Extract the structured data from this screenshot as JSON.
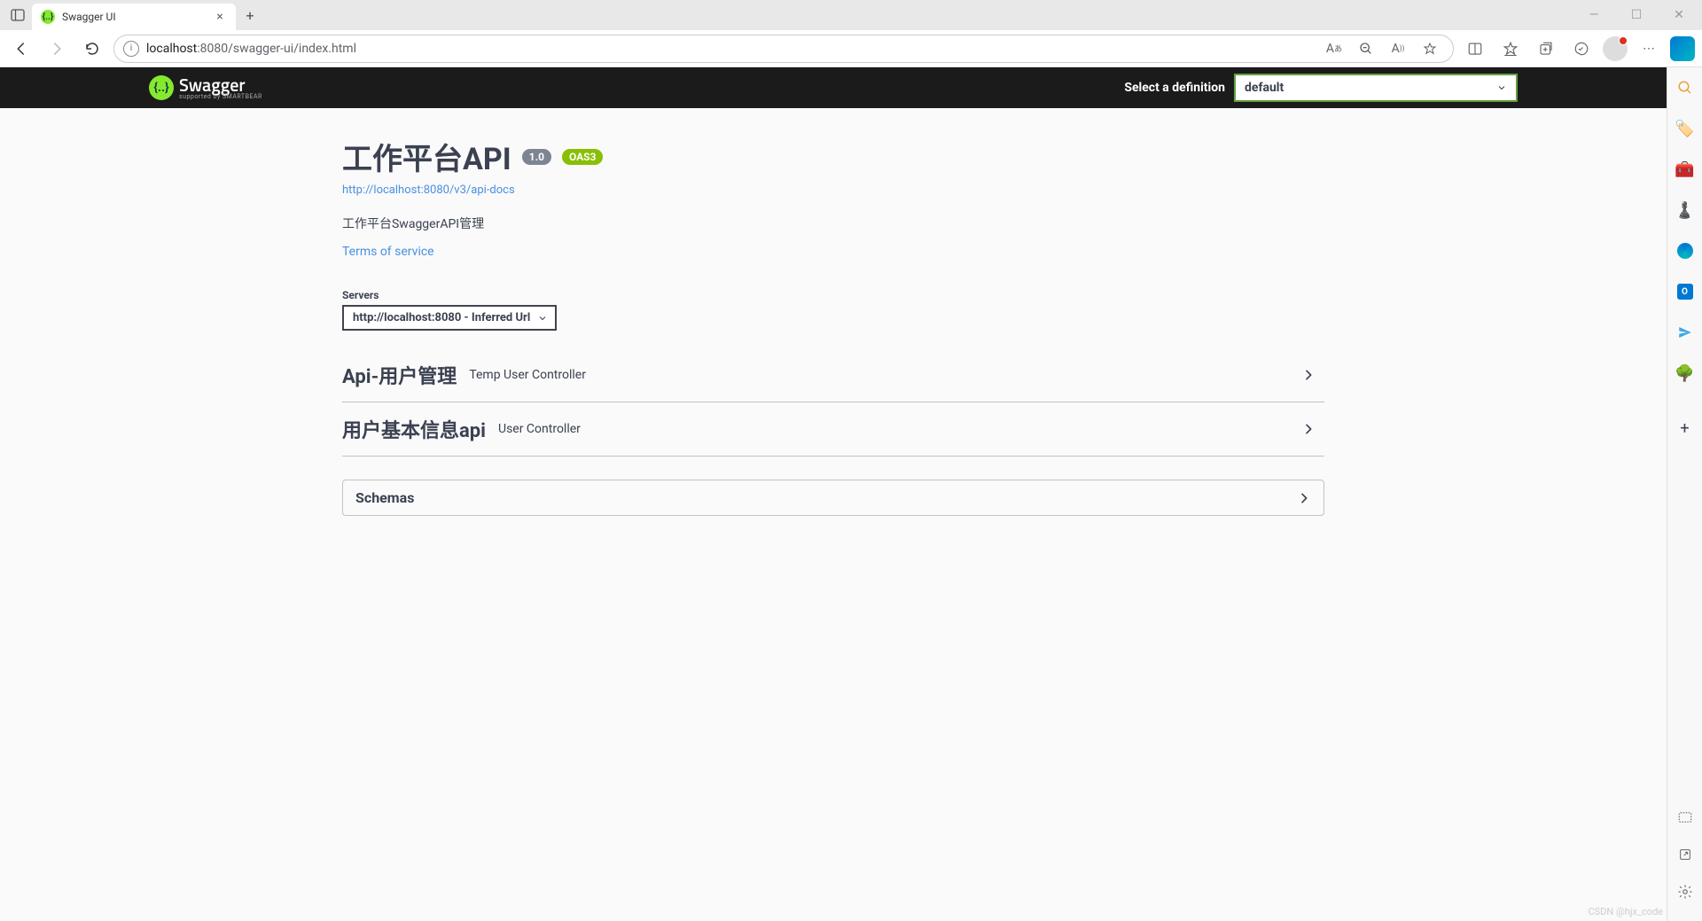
{
  "browser": {
    "tab_title": "Swagger UI",
    "url_prefix": "localhost",
    "url_suffix": ":8080/swagger-ui/index.html"
  },
  "topbar": {
    "logo_name": "Swagger",
    "logo_sub": "supported by SMARTBEAR",
    "def_label": "Select a definition",
    "def_selected": "default"
  },
  "info": {
    "title": "工作平台API",
    "version": "1.0",
    "oas": "OAS3",
    "docs_url": "http://localhost:8080/v3/api-docs",
    "description": "工作平台SwaggerAPI管理",
    "tos": "Terms of service"
  },
  "servers": {
    "label": "Servers",
    "selected": "http://localhost:8080 - Inferred Url"
  },
  "tags": [
    {
      "name": "Api-用户管理",
      "desc": "Temp User Controller"
    },
    {
      "name": "用户基本信息api",
      "desc": "User Controller"
    }
  ],
  "schemas": {
    "title": "Schemas"
  },
  "watermark": "CSDN @hjx_code"
}
